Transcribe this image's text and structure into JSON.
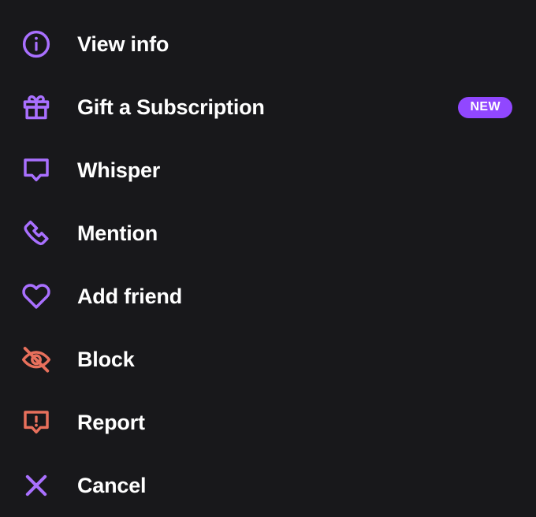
{
  "menu": {
    "name": "user-context-menu",
    "background_color": "#18181b",
    "label_color": "#ffffff",
    "accent_purple": "#a970ff",
    "danger_color": "#e8705c",
    "items": [
      {
        "label": "View info",
        "icon": "info-circle-icon",
        "icon_color": "#a970ff",
        "badge": null
      },
      {
        "label": "Gift a Subscription",
        "icon": "gift-icon",
        "icon_color": "#a970ff",
        "badge": "NEW"
      },
      {
        "label": "Whisper",
        "icon": "speech-bubble-icon",
        "icon_color": "#a970ff",
        "badge": null
      },
      {
        "label": "Mention",
        "icon": "phone-icon",
        "icon_color": "#a970ff",
        "badge": null
      },
      {
        "label": "Add friend",
        "icon": "heart-icon",
        "icon_color": "#a970ff",
        "badge": null
      },
      {
        "label": "Block",
        "icon": "eye-off-icon",
        "icon_color": "#e8705c",
        "badge": null
      },
      {
        "label": "Report",
        "icon": "report-bubble-icon",
        "icon_color": "#e8705c",
        "badge": null
      },
      {
        "label": "Cancel",
        "icon": "close-x-icon",
        "icon_color": "#a970ff",
        "badge": null
      }
    ]
  },
  "badge": {
    "new_label": "NEW",
    "background_color": "#9147ff",
    "text_color": "#ffffff"
  }
}
